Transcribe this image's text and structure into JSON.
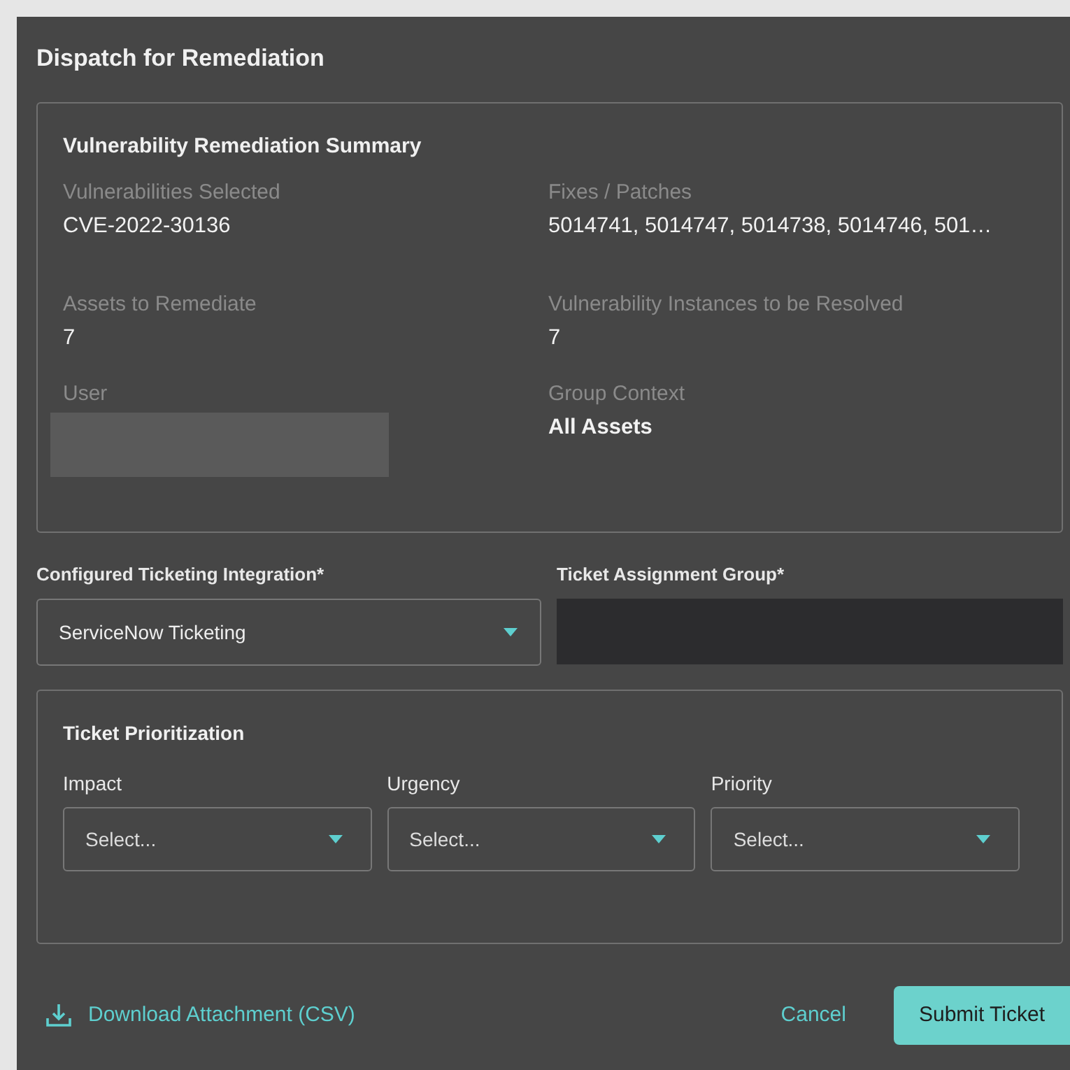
{
  "dialog": {
    "title": "Dispatch for Remediation"
  },
  "summary": {
    "title": "Vulnerability Remediation Summary",
    "fields": [
      {
        "label": "Vulnerabilities Selected",
        "value": "CVE-2022-30136",
        "kind": "text"
      },
      {
        "label": "Fixes / Patches",
        "value": "5014741, 5014747, 5014738, 5014746, 501…",
        "kind": "text"
      },
      {
        "label": "Assets to Remediate",
        "value": "7",
        "kind": "text"
      },
      {
        "label": "Vulnerability Instances to be Resolved",
        "value": "7",
        "kind": "text"
      },
      {
        "label": "User",
        "kind": "redacted"
      },
      {
        "label": "Group Context",
        "value": "All Assets",
        "kind": "bold"
      }
    ]
  },
  "integration": {
    "label": "Configured Ticketing Integration*",
    "value": "ServiceNow Ticketing"
  },
  "assignment_group": {
    "label": "Ticket Assignment Group*"
  },
  "prioritization": {
    "title": "Ticket Prioritization",
    "selects": [
      {
        "label": "Impact",
        "placeholder": "Select..."
      },
      {
        "label": "Urgency",
        "placeholder": "Select..."
      },
      {
        "label": "Priority",
        "placeholder": "Select..."
      }
    ]
  },
  "footer": {
    "download_link": "Download Attachment (CSV)",
    "cancel": "Cancel",
    "submit": "Submit Ticket"
  }
}
